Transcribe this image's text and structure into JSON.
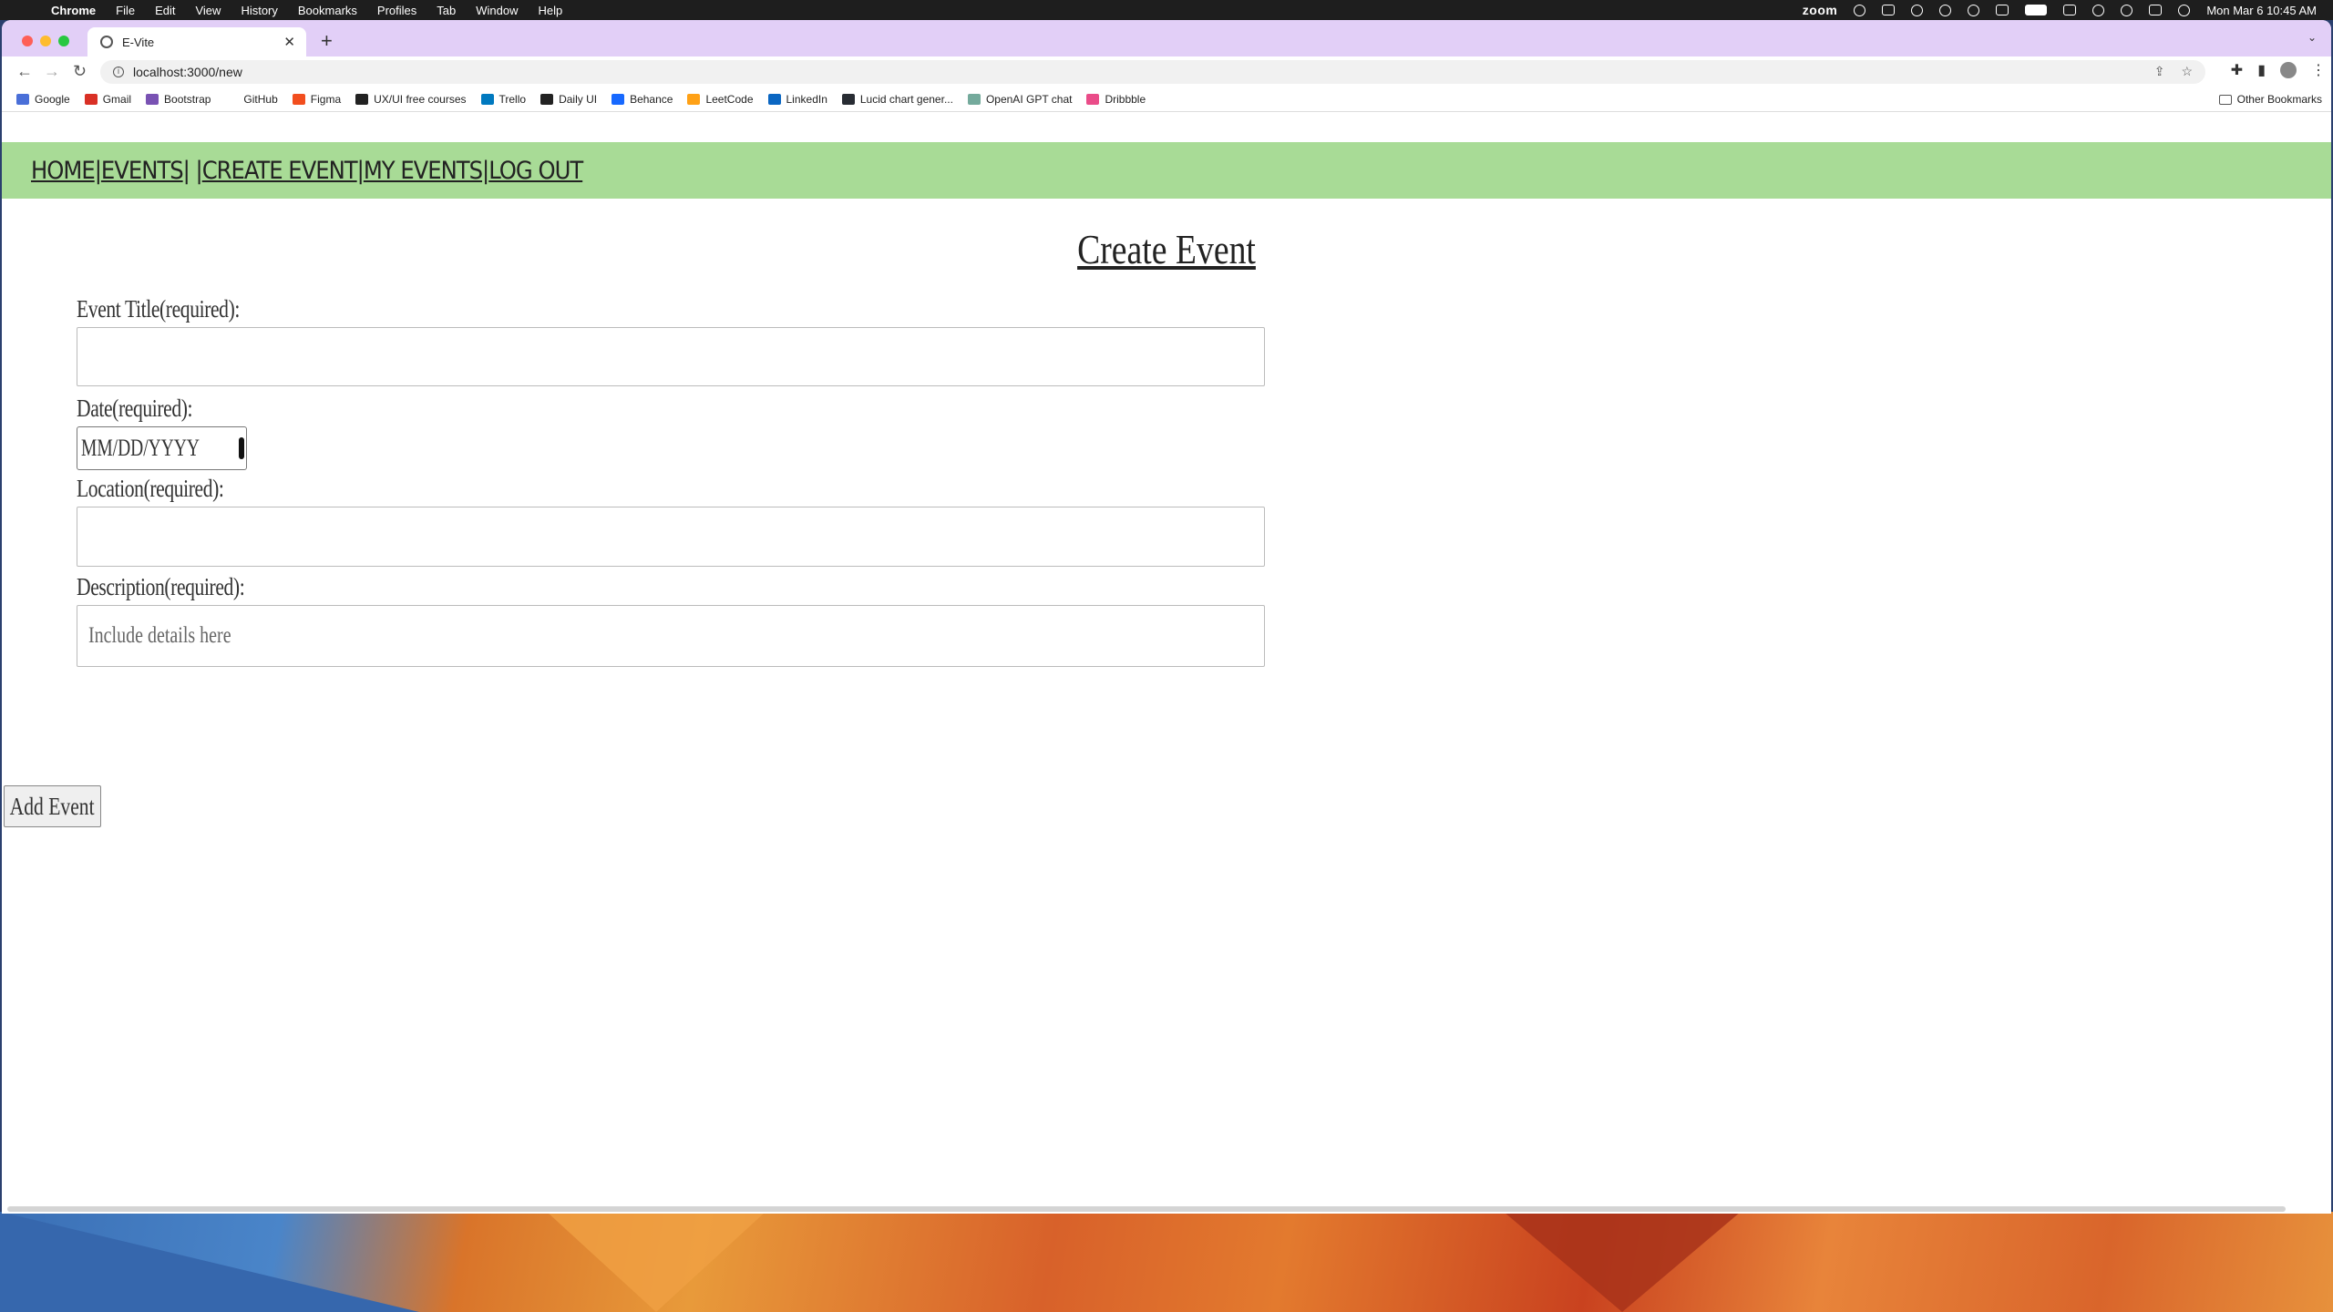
{
  "menubar": {
    "app": "Chrome",
    "items": [
      "File",
      "Edit",
      "View",
      "History",
      "Bookmarks",
      "Profiles",
      "Tab",
      "Window",
      "Help"
    ],
    "zoom_label": "zoom",
    "datetime": "Mon Mar 6  10:45 AM"
  },
  "browser": {
    "tab_title": "E-Vite",
    "url": "localhost:3000/new",
    "bookmarks": [
      {
        "label": "Google",
        "color": "#4a6fd8"
      },
      {
        "label": "Gmail",
        "color": "#d93025"
      },
      {
        "label": "Bootstrap",
        "color": "#7952b3"
      },
      {
        "label": "GitHub",
        "color": "#ffffff"
      },
      {
        "label": "Figma",
        "color": "#f24e1e"
      },
      {
        "label": "UX/UI free courses",
        "color": "#222222"
      },
      {
        "label": "Trello",
        "color": "#0079bf"
      },
      {
        "label": "Daily UI",
        "color": "#222222"
      },
      {
        "label": "Behance",
        "color": "#1769ff"
      },
      {
        "label": "LeetCode",
        "color": "#ffa116"
      },
      {
        "label": "LinkedIn",
        "color": "#0a66c2"
      },
      {
        "label": "Lucid chart gener...",
        "color": "#282c33"
      },
      {
        "label": "OpenAI GPT chat",
        "color": "#74aa9c"
      },
      {
        "label": "Dribbble",
        "color": "#ea4c89"
      }
    ],
    "other_bookmarks": "Other Bookmarks"
  },
  "site_nav": {
    "home": "HOME",
    "events": "EVENTS",
    "create_event": "CREATE EVENT",
    "my_events": "MY EVENTS",
    "log_out": "LOG OUT"
  },
  "page": {
    "title": "Create Event",
    "event_title_label": "Event Title(required):",
    "date_label": "Date(required):",
    "date_placeholder": "mm/dd/yyyy",
    "location_label": "Location(required):",
    "description_label": "Description(required):",
    "description_placeholder": "Include details here",
    "submit_label": "Add Event"
  },
  "colors": {
    "nav_bg": "#a8db96",
    "tabstrip_bg": "#e2cff7"
  }
}
